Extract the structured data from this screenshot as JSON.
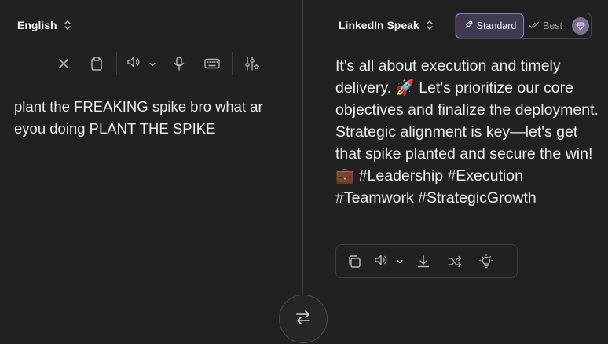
{
  "source": {
    "language": "English",
    "text": "plant the FREAKING spike bro what ar eyou doing PLANT THE SPIKE"
  },
  "target": {
    "language": "LinkedIn Speak",
    "text": "It's all about execution and timely delivery. 🚀 Let's prioritize our core objectives and finalize the deployment. Strategic alignment is key—let's get that spike planted and secure the win! 💼 #Leadership #Execution #Teamwork #StrategicGrowth"
  },
  "mode": {
    "standard_label": "Standard",
    "best_label": "Best",
    "selected": "Standard"
  },
  "colors": {
    "background": "#212121",
    "accent": "#8a7ec4",
    "divider": "#3d3d3d"
  },
  "icons": {
    "source_toolbar": [
      "close-icon",
      "clipboard-icon",
      "speaker-icon",
      "chevron-down-icon",
      "microphone-icon",
      "keyboard-icon",
      "settings-sliders-icon"
    ],
    "target_toolbar": [
      "copy-icon",
      "speaker-icon",
      "chevron-down-icon",
      "download-icon",
      "shuffle-icon",
      "lightbulb-icon"
    ],
    "swap": "swap-arrows-icon"
  }
}
